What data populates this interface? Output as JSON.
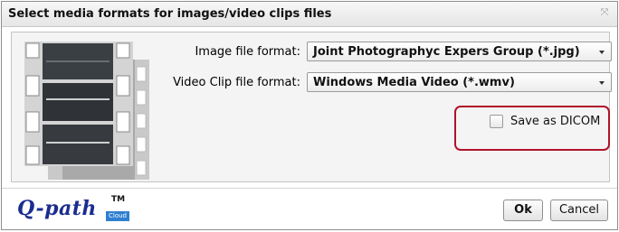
{
  "dialog": {
    "title": "Select media formats for images/video clips files",
    "close_icon": "close-icon"
  },
  "form": {
    "image_label": "Image file format:",
    "image_value": "Joint Photographyc Expers Group (*.jpg)",
    "video_label": "Video Clip file format:",
    "video_value": "Windows Media Video (*.wmv)",
    "dicom_label": "Save as DICOM",
    "dicom_checked": false,
    "highlight_color": "#b0132a"
  },
  "logo": {
    "text": "Q-path",
    "tm": "TM",
    "badge": "Cloud"
  },
  "buttons": {
    "ok": "Ok",
    "cancel": "Cancel"
  }
}
